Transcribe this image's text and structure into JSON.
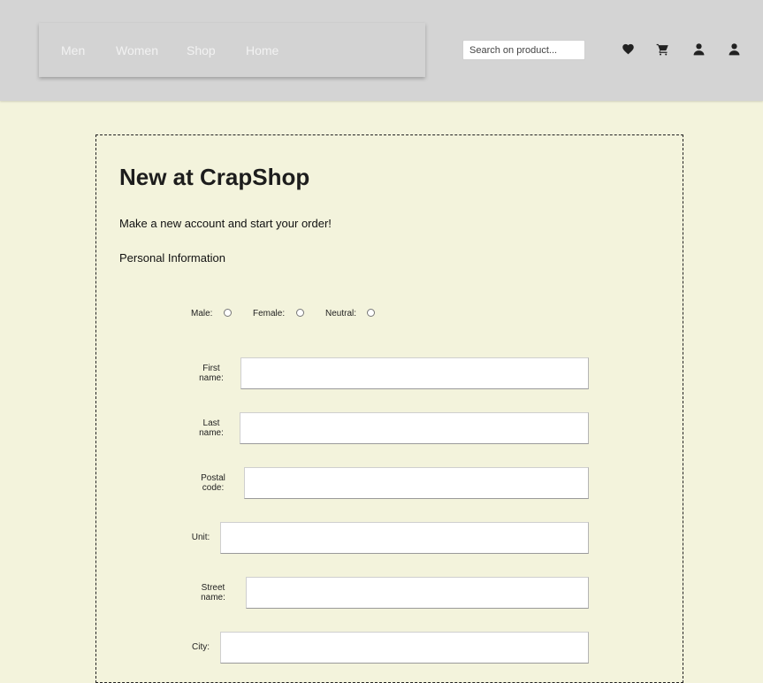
{
  "nav": {
    "items": [
      {
        "label": "Men"
      },
      {
        "label": "Women"
      },
      {
        "label": "Shop"
      },
      {
        "label": "Home"
      }
    ]
  },
  "search": {
    "placeholder": "Search on product..."
  },
  "icons": [
    "heart-icon",
    "cart-icon",
    "user-icon",
    "account-icon"
  ],
  "form": {
    "title": "New at CrapShop",
    "subtitle": "Make a new account and start your order!",
    "section": "Personal Information",
    "gender": [
      {
        "label": "Male:"
      },
      {
        "label": "Female:"
      },
      {
        "label": "Neutral:"
      }
    ],
    "fields": [
      {
        "label_1": "First",
        "label_2": "name:",
        "value": ""
      },
      {
        "label_1": "Last",
        "label_2": "name:",
        "value": ""
      },
      {
        "label_1": "Postal",
        "label_2": "code:",
        "value": ""
      },
      {
        "label_1": "Unit:",
        "label_2": "",
        "value": ""
      },
      {
        "label_1": "Street",
        "label_2": "name:",
        "value": ""
      },
      {
        "label_1": "City:",
        "label_2": "",
        "value": ""
      }
    ]
  },
  "colors": {
    "header_bg": "#d4d4d4",
    "page_bg": "#f3f3dc",
    "nav_text": "#f2f2f2",
    "title_text": "#1d1d1d"
  }
}
